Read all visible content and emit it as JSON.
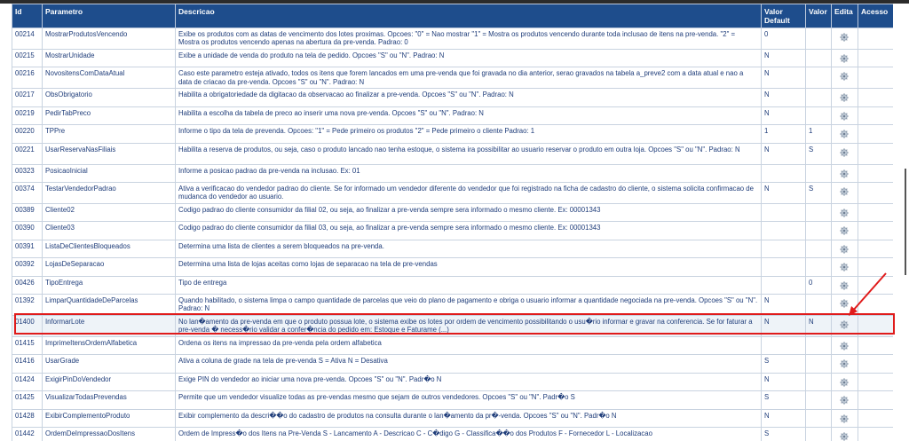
{
  "table": {
    "headers": {
      "id": "Id",
      "parametro": "Parametro",
      "descricao": "Descricao",
      "valor_default": "Valor Default",
      "valor": "Valor",
      "edita": "Edita",
      "acesso": "Acesso"
    },
    "rows": [
      {
        "id": "00214",
        "param": "MostrarProdutosVencendo",
        "desc": "Exibe os produtos com as datas de vencimento dos lotes proximas. Opcoes: \"0\" = Nao mostrar \"1\" = Mostra os produtos vencendo durante toda inclusao de itens na pre-venda. \"2\" = Mostra os produtos vencendo apenas na abertura da pre-venda. Padrao: 0",
        "def": "0",
        "val": ""
      },
      {
        "id": "00215",
        "param": "MostrarUnidade",
        "desc": "Exibe a unidade de venda do produto na tela de pedido. Opcoes \"S\" ou \"N\". Padrao: N",
        "def": "N",
        "val": ""
      },
      {
        "id": "00216",
        "param": "NovositensComDataAtual",
        "desc": "Caso este parametro esteja ativado, todos os itens que forem lancados em uma pre-venda que foi gravada no dia anterior, serao gravados na tabela a_preve2 com a data atual e nao a data de criacao da pre-venda. Opcoes \"S\" ou \"N\". Padrao: N",
        "def": "N",
        "val": ""
      },
      {
        "id": "00217",
        "param": "ObsObrigatorio",
        "desc": "Habilita a obrigatoriedade da digitacao da observacao ao finalizar a pre-venda. Opcoes \"S\" ou \"N\". Padrao: N",
        "def": "N",
        "val": ""
      },
      {
        "id": "00219",
        "param": "PedirTabPreco",
        "desc": "Habilita a escolha da tabela de preco ao inserir uma nova pre-venda. Opcoes \"S\" ou \"N\". Padrao: N",
        "def": "N",
        "val": ""
      },
      {
        "id": "00220",
        "param": "TPPre",
        "desc": "Informe o tipo da tela de prevenda. Opcoes: \"1\" = Pede primeiro os produtos \"2\" = Pede primeiro o cliente Padrao: 1",
        "def": "1",
        "val": "1"
      },
      {
        "id": "00221",
        "param": "UsarReservaNasFiliais",
        "desc": "Habilita a reserva de produtos, ou seja, caso o produto lancado nao tenha estoque, o sistema ira possibilitar ao usuario reservar o produto em outra loja. Opcoes \"S\" ou \"N\". Padrao: N",
        "def": "N",
        "val": "S"
      },
      {
        "id": "00323",
        "param": "PosicaoInicial",
        "desc": "Informe a posicao padrao da pre-venda na inclusao. Ex: 01",
        "def": "",
        "val": ""
      },
      {
        "id": "00374",
        "param": "TestarVendedorPadrao",
        "desc": "Ativa a verificacao do vendedor padrao do cliente. Se for informado um vendedor diferente do vendedor que foi registrado na ficha de cadastro do cliente, o sistema solicita confirmacao de mudanca do vendedor ao usuario.",
        "def": "N",
        "val": "S"
      },
      {
        "id": "00389",
        "param": "Cliente02",
        "desc": "Codigo padrao do cliente consumidor da filial 02, ou seja, ao finalizar a pre-venda sempre sera informado o mesmo cliente. Ex: 00001343",
        "def": "",
        "val": ""
      },
      {
        "id": "00390",
        "param": "Cliente03",
        "desc": "Codigo padrao do cliente consumidor da filial 03, ou seja, ao finalizar a pre-venda sempre sera informado o mesmo cliente. Ex: 00001343",
        "def": "",
        "val": ""
      },
      {
        "id": "00391",
        "param": "ListaDeClientesBloqueados",
        "desc": "Determina uma lista de clientes a serem bloqueados na pre-venda.",
        "def": "",
        "val": ""
      },
      {
        "id": "00392",
        "param": "LojasDeSeparacao",
        "desc": "Determina uma lista de lojas aceitas como lojas de separacao na tela de pre-vendas",
        "def": "",
        "val": ""
      },
      {
        "id": "00426",
        "param": "TipoEntrega",
        "desc": "Tipo de entrega",
        "def": "",
        "val": "0"
      },
      {
        "id": "01392",
        "param": "LimparQuantidadeDeParcelas",
        "desc": "Quando habilitado, o sistema limpa o campo quantidade de parcelas que veio do plano de pagamento e obriga o usuario informar a quantidade negociada na pre-venda. Opcoes \"S\" ou \"N\". Padrao: N",
        "def": "N",
        "val": ""
      },
      {
        "id": "01400",
        "param": "InformarLote",
        "desc": "No lan�amento da pre-venda em que o produto possua lote, o sistema exibe os lotes por ordem de vencimento possibilitando o usu�rio informar e gravar na conferencia. Se for faturar a pre-venda � necess�rio validar a confer�ncia do pedido em: Estoque e Faturame (...)",
        "def": "N",
        "val": "N",
        "hl": true
      },
      {
        "id": "01415",
        "param": "ImprimeItensOrdemAlfabetica",
        "desc": "Ordena os itens na impressao da pre-venda pela ordem alfabetica",
        "def": "",
        "val": ""
      },
      {
        "id": "01416",
        "param": "UsarGrade",
        "desc": "Ativa a coluna de grade na tela de pre-venda S = Ativa N = Desativa",
        "def": "S",
        "val": ""
      },
      {
        "id": "01424",
        "param": "ExigirPinDoVendedor",
        "desc": "Exige PIN do vendedor ao iniciar uma nova pre-venda. Opcoes \"S\" ou \"N\". Padr�o N",
        "def": "N",
        "val": ""
      },
      {
        "id": "01425",
        "param": "VisualizarTodasPrevendas",
        "desc": "Permite que um vendedor visualize todas as pre-vendas mesmo que sejam de outros vendedores. Opcoes \"S\" ou \"N\". Padr�o S",
        "def": "S",
        "val": ""
      },
      {
        "id": "01428",
        "param": "ExibirComplementoProduto",
        "desc": "Exibir complemento da descri��o do cadastro de produtos na consulta durante o lan�amento da pr�-venda. Opcoes \"S\" ou \"N\". Padr�o N",
        "def": "N",
        "val": ""
      },
      {
        "id": "01442",
        "param": "OrdemDeImpressaoDosItens",
        "desc": "Ordem de Impress�o dos Itens na Pre-Venda S - Lancamento A - Descricao C - C�digo G - Classifica��o dos Produtos F - Fornecedor L - Localizacao",
        "def": "S",
        "val": ""
      }
    ]
  }
}
